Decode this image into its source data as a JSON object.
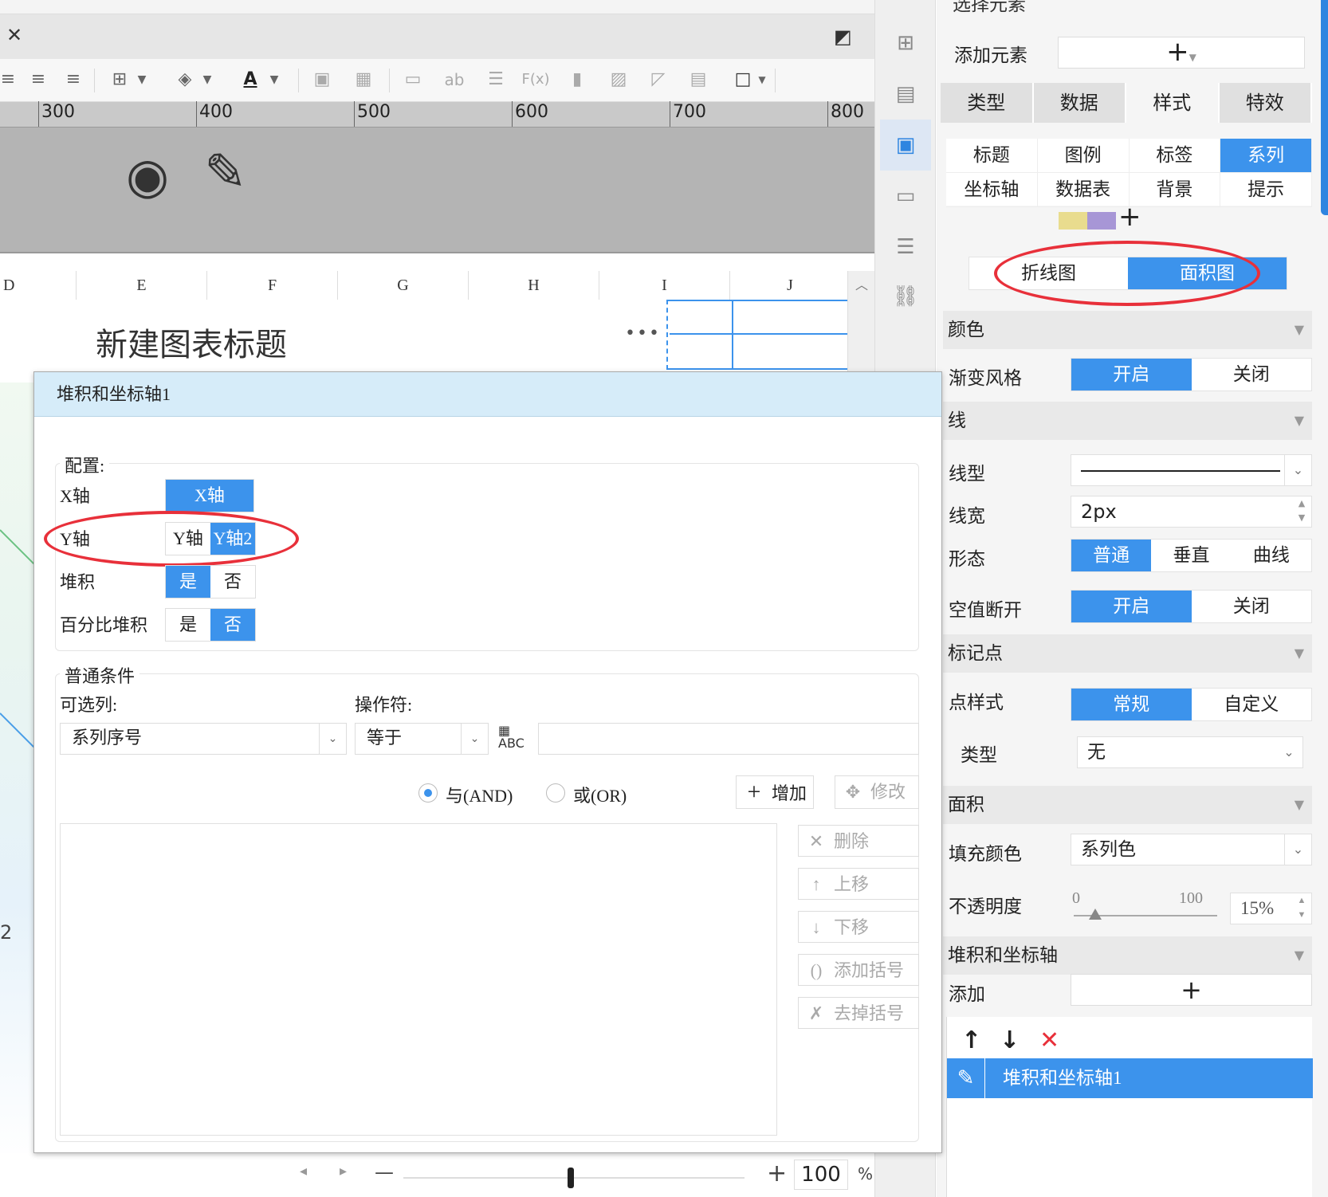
{
  "toolbar": {
    "close_symbol": "✕",
    "text_label": "ab",
    "fx_label": "F(x)",
    "font_color_label": "A"
  },
  "ruler": {
    "labels": [
      "300",
      "400",
      "500",
      "600",
      "700",
      "800"
    ]
  },
  "columns": [
    "D",
    "E",
    "F",
    "G",
    "H",
    "I",
    "J"
  ],
  "sheet": {
    "chart_title": "新建图表标题",
    "more_symbol": "•••",
    "row_label_2": "2"
  },
  "zoom": {
    "minus": "—",
    "plus": "+",
    "value": "100",
    "unit": "%"
  },
  "panel": {
    "top_cut": "选择元素",
    "add_element_label": "添加元素",
    "add_symbol": "+",
    "main_tabs": [
      "类型",
      "数据",
      "样式",
      "特效"
    ],
    "sub_tabs": [
      "标题",
      "图例",
      "标签",
      "系列",
      "坐标轴",
      "数据表",
      "背景",
      "提示"
    ],
    "swatch_colors": [
      "#e9dc8e",
      "#a796d6"
    ],
    "chart_type": {
      "line": "折线图",
      "area": "面积图"
    },
    "color_section": "颜色",
    "gradient_label": "渐变风格",
    "on": "开启",
    "off": "关闭",
    "line_section": "线",
    "line_type_label": "线型",
    "line_width_label": "线宽",
    "line_width_value": "2px",
    "shape_label": "形态",
    "shape_options": [
      "普通",
      "垂直",
      "曲线"
    ],
    "null_break_label": "空值断开",
    "marker_section": "标记点",
    "point_style_label": "点样式",
    "point_style_options": [
      "常规",
      "自定义"
    ],
    "type_label": "类型",
    "type_value": "无",
    "area_section": "面积",
    "fill_color_label": "填充颜色",
    "fill_color_value": "系列色",
    "opacity_label": "不透明度",
    "opacity_min": "0",
    "opacity_max": "100",
    "opacity_value": "15%",
    "opacity_fraction": 0.15,
    "stack_section": "堆积和坐标轴",
    "add_label": "添加",
    "list_item": "堆积和坐标轴1"
  },
  "dialog": {
    "title": "堆积和坐标轴1",
    "config_legend": "配置:",
    "x_axis_label": "X轴",
    "x_axis_option": "X轴",
    "y_axis_label": "Y轴",
    "y_axis_options": [
      "Y轴",
      "Y轴2"
    ],
    "stack_label": "堆积",
    "percent_stack_label": "百分比堆积",
    "yes": "是",
    "no": "否",
    "cond_legend": "普通条件",
    "column_label": "可选列:",
    "column_value": "系列序号",
    "operator_label": "操作符:",
    "operator_value": "等于",
    "and_label": "与(AND)",
    "or_label": "或(OR)",
    "add_btn": "增加",
    "modify_btn": "修改",
    "delete_btn": "删除",
    "up_btn": "上移",
    "down_btn": "下移",
    "add_bracket_btn": "添加括号",
    "remove_bracket_btn": "去掉括号"
  },
  "colors": {
    "accent": "#3c93ec",
    "highlight_ring": "#e8303a",
    "dialog_header": "#d6ecf9"
  }
}
